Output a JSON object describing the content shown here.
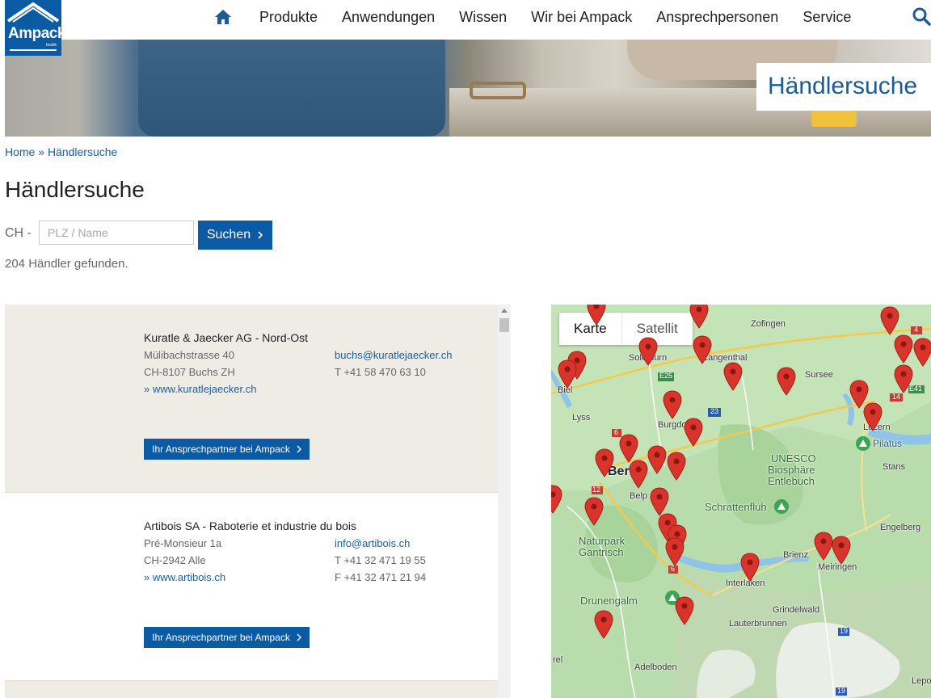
{
  "header": {
    "logo_text": "Ampack",
    "logo_sub": "bostik",
    "nav": [
      "Produkte",
      "Anwendungen",
      "Wissen",
      "Wir bei Ampack",
      "Ansprechpersonen",
      "Service"
    ],
    "hero_title": "Händlersuche"
  },
  "breadcrumb": {
    "home": "Home",
    "sep": "»",
    "current": "Händlersuche"
  },
  "page_title": "Händlersuche",
  "search": {
    "country": "CH -",
    "placeholder": "PLZ / Name",
    "button": "Suchen",
    "result_text": "204 Händler gefunden."
  },
  "dealers": [
    {
      "name": "Kuratle & Jaecker AG - Nord-Ost",
      "street": "Mülibachstrasse 40",
      "city": "CH-8107 Buchs ZH",
      "web": "» www.kuratlejaecker.ch",
      "email": "buchs@kuratlejaecker.ch",
      "tel": "T +41 58 470 63 10",
      "fax": "",
      "button": "Ihr Ansprechpartner bei Ampack"
    },
    {
      "name": "Artibois SA - Raboterie et industrie du bois",
      "street": "Pré-Monsieur 1a",
      "city": "CH-2942 Alle",
      "web": "» www.artibois.ch",
      "email": "info@artibois.ch",
      "tel": "T +41 32 471 19 55",
      "fax": "F +41 32 471 21 94",
      "button": "Ihr Ansprechpartner bei Ampack"
    }
  ],
  "map": {
    "tabs": [
      "Karte",
      "Satellit"
    ],
    "places": [
      "Zofingen",
      "Solothurn",
      "Langenthal",
      "Sursee",
      "Biel",
      "Lyss",
      "Burgdorf",
      "Luzern",
      "Pilatus",
      "Stans",
      "Bern",
      "Belp",
      "UNESCO",
      "Biosphäre",
      "Entlebuch",
      "Schrattenfluh",
      "Engelberg",
      "Naturpark",
      "Gantrisch",
      "Brienz",
      "Meiringen",
      "Interlaken",
      "Drunengalm",
      "Grindelwald",
      "Lauterbrunnen",
      "Adelboden",
      "Lepo",
      "rel"
    ],
    "road_labels": [
      "E25",
      "23",
      "6",
      "12",
      "6",
      "14",
      "E41",
      "4",
      "19",
      "19"
    ],
    "colors": {
      "pin": "#d8342c",
      "water": "#8fc3e8",
      "land": "#b7dcaa"
    }
  }
}
